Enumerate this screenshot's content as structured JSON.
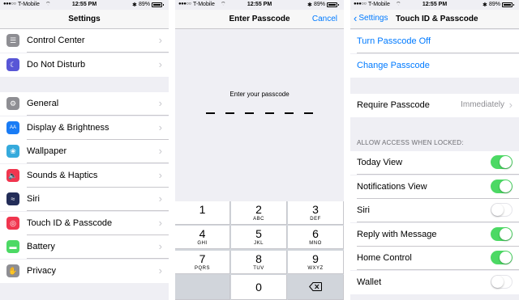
{
  "status_bar": {
    "carrier": "T-Mobile",
    "time": "12:55 PM",
    "battery": "89%"
  },
  "settings": {
    "title": "Settings",
    "group1": [
      "Control Center",
      "Do Not Disturb"
    ],
    "group2": [
      {
        "label": "General",
        "icon": "gear-icon",
        "color": "#8e8e93",
        "glyph": "⚙"
      },
      {
        "label": "Display & Brightness",
        "icon": "text-size-icon",
        "color": "#1a7cf5",
        "glyph": "AA"
      },
      {
        "label": "Wallpaper",
        "icon": "wallpaper-flower-icon",
        "color": "#35aadc",
        "glyph": "❀"
      },
      {
        "label": "Sounds & Haptics",
        "icon": "speaker-icon",
        "color": "#f0364f",
        "glyph": "🔈"
      },
      {
        "label": "Siri",
        "icon": "siri-icon",
        "color": "#232d58",
        "glyph": "≈"
      },
      {
        "label": "Touch ID & Passcode",
        "icon": "fingerprint-icon",
        "color": "#f0364f",
        "glyph": "◎"
      },
      {
        "label": "Battery",
        "icon": "battery-icon",
        "color": "#4cd964",
        "glyph": "▬"
      },
      {
        "label": "Privacy",
        "icon": "hand-icon",
        "color": "#8e8e93",
        "glyph": "✋"
      }
    ],
    "group1_icons": [
      {
        "icon": "control-center-icon",
        "color": "#8e8e93",
        "glyph": "☰"
      },
      {
        "icon": "moon-icon",
        "color": "#5856d6",
        "glyph": "☾"
      }
    ]
  },
  "passcode": {
    "title": "Enter Passcode",
    "cancel": "Cancel",
    "prompt": "Enter your passcode",
    "keys": [
      {
        "num": "1",
        "letters": ""
      },
      {
        "num": "2",
        "letters": "ABC"
      },
      {
        "num": "3",
        "letters": "DEF"
      },
      {
        "num": "4",
        "letters": "GHI"
      },
      {
        "num": "5",
        "letters": "JKL"
      },
      {
        "num": "6",
        "letters": "MNO"
      },
      {
        "num": "7",
        "letters": "PQRS"
      },
      {
        "num": "8",
        "letters": "TUV"
      },
      {
        "num": "9",
        "letters": "WXYZ"
      },
      {
        "num": "0",
        "letters": ""
      }
    ]
  },
  "touchid": {
    "back": "Settings",
    "title": "Touch ID & Passcode",
    "turn_off": "Turn Passcode Off",
    "change": "Change Passcode",
    "require_label": "Require Passcode",
    "require_value": "Immediately",
    "section_header": "ALLOW ACCESS WHEN LOCKED:",
    "toggles": [
      {
        "label": "Today View",
        "on": true
      },
      {
        "label": "Notifications View",
        "on": true
      },
      {
        "label": "Siri",
        "on": false
      },
      {
        "label": "Reply with Message",
        "on": true
      },
      {
        "label": "Home Control",
        "on": true
      },
      {
        "label": "Wallet",
        "on": false
      }
    ]
  }
}
